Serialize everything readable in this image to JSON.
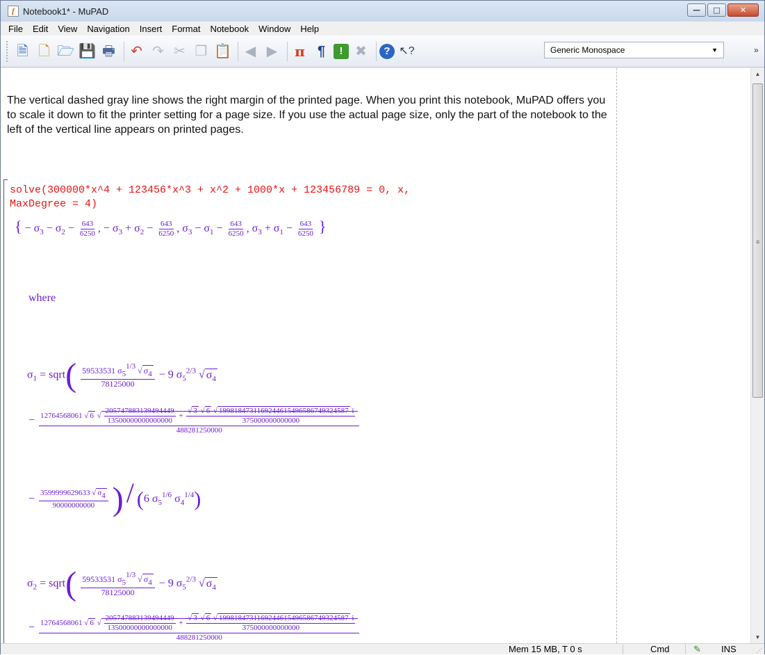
{
  "window": {
    "title": "Notebook1* - MuPAD"
  },
  "menu": [
    "File",
    "Edit",
    "View",
    "Navigation",
    "Insert",
    "Format",
    "Notebook",
    "Window",
    "Help"
  ],
  "toolbar": {
    "font": "Generic Monospace",
    "icons": [
      "new-notebook-icon",
      "new-editor-icon",
      "open-icon",
      "save-icon",
      "print-icon",
      "undo-icon",
      "redo-icon",
      "cut-icon",
      "copy-icon",
      "paste-icon",
      "back-icon",
      "forward-icon",
      "insert-calculation-icon",
      "insert-text-icon",
      "evaluate-icon",
      "stop-icon",
      "help-icon",
      "context-help-icon"
    ]
  },
  "document": {
    "text": "The vertical dashed gray line shows the right margin of the printed page. When you print this notebook, MuPAD offers you to scale it down to fit the printer setting for a page size. If you use the actual page size, only the part of the notebook to the left of the vertical line appears on printed pages.",
    "command": "solve(300000*x^4 + 123456*x^3 + x^2 + 1000*x + 123456789 = 0, x,\nMaxDegree = 4)",
    "where": "where",
    "fraction_643_6250": [
      "643",
      "6250"
    ],
    "coeff_59533531": "59533531",
    "den_78125000": "78125000",
    "minus_9": "9",
    "coeff_12764568061": "12764568061",
    "num_205747883139494449": "205747883139494449",
    "den_13500000000000000": "13500000000000000",
    "num_1998184731169244615496586749324587": "1998184731169244615496586749324587",
    "unit_i": "i",
    "den_375000000000000": "375000000000000",
    "den_488281250000": "488281250000",
    "coeff_3599999629633": "3599999629633",
    "den_90000000000": "90000000000",
    "six": "6"
  },
  "status": {
    "memory": "Mem 15 MB, T 0 s",
    "mode": "Cmd",
    "insert": "INS"
  }
}
